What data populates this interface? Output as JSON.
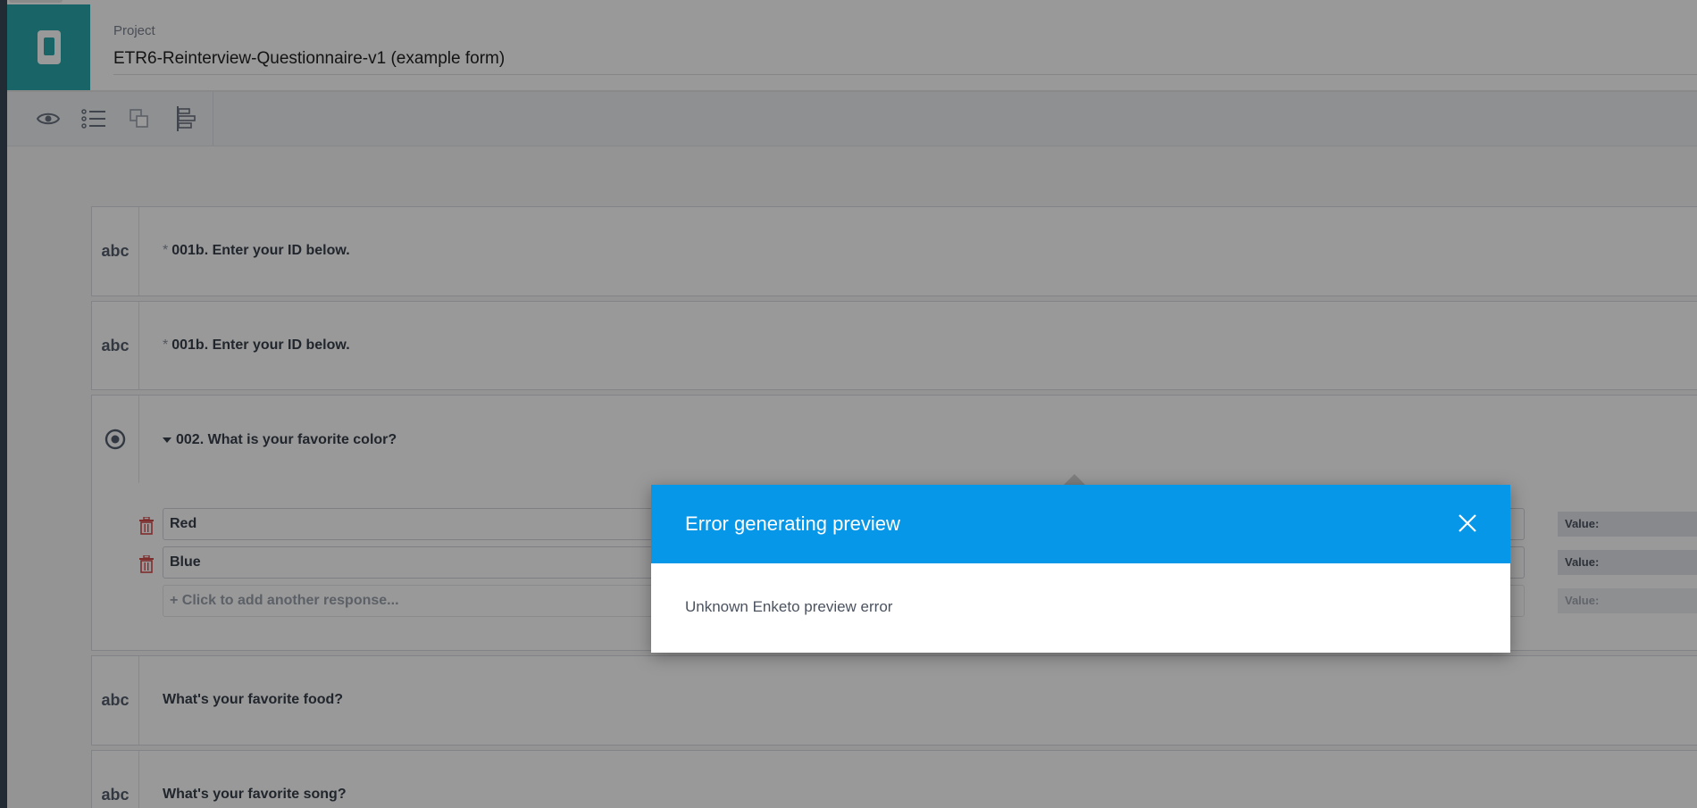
{
  "header": {
    "project_caption": "Project",
    "project_name": "ETR6-Reinterview-Questionnaire-v1 (example form)",
    "logo_icon": "mobile-form-icon",
    "accent_color": "#2aa7ac"
  },
  "toolbar": {
    "tools": [
      {
        "icon": "eye-icon"
      },
      {
        "icon": "list-icon"
      },
      {
        "icon": "group-icon"
      },
      {
        "icon": "outline-icon"
      }
    ]
  },
  "questions": [
    {
      "type": "abc",
      "required_mark": "*",
      "label": "001b. Enter your ID below."
    },
    {
      "type": "abc",
      "required_mark": "*",
      "label": "001b. Enter your ID below."
    },
    {
      "type_icon": "radio-icon",
      "label": "002. What is your favorite color?"
    },
    {
      "type": "abc",
      "label": "What's your favorite food?"
    },
    {
      "type": "abc",
      "label": "What's your favorite song?"
    }
  ],
  "options": [
    {
      "label": "Red",
      "value_label": "Value:"
    },
    {
      "label": "Blue",
      "value_label": "Value:"
    }
  ],
  "add_option": {
    "label": "+ Click to add another response...",
    "value_label": "Value:"
  },
  "modal": {
    "title": "Error generating preview",
    "message": "Unknown Enketo preview error",
    "header_color": "#0797e9"
  }
}
